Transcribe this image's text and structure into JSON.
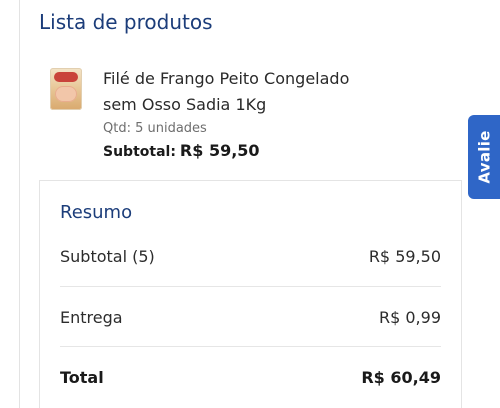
{
  "section_title": "Lista de produtos",
  "product": {
    "image_icon": "product-thumbnail-icon",
    "name_line1": "Filé de Frango Peito Congelado",
    "name_line2": "sem Osso Sadia 1Kg",
    "quantity": "Qtd: 5 unidades",
    "subtotal_label": "Subtotal:",
    "subtotal_value": "R$ 59,50"
  },
  "summary": {
    "title": "Resumo",
    "rows": [
      {
        "label": "Subtotal (5)",
        "value": "R$ 59,50"
      },
      {
        "label": "Entrega",
        "value": "R$ 0,99"
      },
      {
        "label": "Total",
        "value": "R$ 60,49"
      }
    ]
  },
  "feedback_tab": {
    "label": "Avalie"
  },
  "colors": {
    "heading_blue": "#1c3d7a",
    "tab_blue": "#2f66c7"
  }
}
